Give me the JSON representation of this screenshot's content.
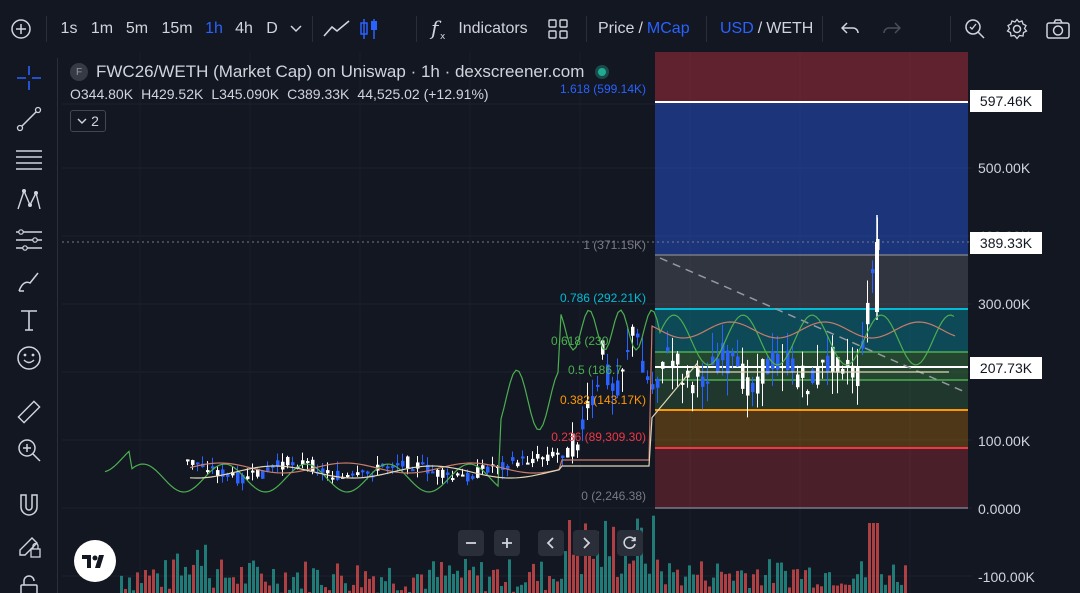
{
  "toolbar": {
    "intervals": [
      "1s",
      "1m",
      "5m",
      "15m",
      "1h",
      "4h",
      "D"
    ],
    "active_interval": "1h",
    "indicators_label": "Indicators",
    "price_label": "Price",
    "slash": "/",
    "mcap_label": "MCap",
    "usd_label": "USD",
    "weth_label": "WETH"
  },
  "legend": {
    "badge": "F",
    "title": "FWC26/WETH (Market Cap) on Uniswap · 1h · dexscreener.com",
    "o_label": "O",
    "o_value": "344.80K",
    "h_label": "H",
    "h_value": "429.52K",
    "l_label": "L",
    "l_value": "345.090K",
    "c_label": "C",
    "c_value": "389.33K",
    "change": "44,525.02 (+12.91%)",
    "indicator_count": "2"
  },
  "price_axis": {
    "labels": [
      "500.00K",
      "300.00K",
      "100.00K",
      "0.0000",
      "-100.00K"
    ],
    "tags": [
      "597.46K",
      "389.33K",
      "207.73K"
    ],
    "partial_label": "400.00K"
  },
  "fib": {
    "levels": [
      {
        "text": "1.618 (599.14K)",
        "color": "#2962ff"
      },
      {
        "text": "1 (371.15K)",
        "color": "#787b86"
      },
      {
        "text": "0.786 (292.21K)",
        "color": "#00bcd4"
      },
      {
        "text": "0.618 (230",
        "color": "#4caf50"
      },
      {
        "text": "0.5 (186.7",
        "color": "#4caf50"
      },
      {
        "text": "0.382 (143.17K)",
        "color": "#ff9800"
      },
      {
        "text": "0.236 (89,309.30)",
        "color": "#f23645"
      },
      {
        "text": "0 (2,246.38)",
        "color": "#787b86"
      }
    ]
  },
  "colors": {
    "background": "#131722",
    "accent": "#2962ff",
    "up": "#ffffff",
    "down": "#2962ff",
    "volume_up": "#26a69a",
    "volume_down": "#ef5350"
  },
  "icons": {
    "left": [
      "crosshair-icon",
      "trend-line-icon",
      "fib-retracement-icon",
      "pattern-icon",
      "prediction-icon",
      "brush-icon",
      "text-icon",
      "emoji-icon",
      "ruler-icon",
      "zoom-in-icon",
      "magnet-icon",
      "lock-drawing-icon",
      "lock-icon"
    ],
    "top": [
      "add-symbol-icon",
      "chart-type-icon",
      "candles-icon",
      "indicators-icon",
      "layouts-icon",
      "undo-icon",
      "redo-icon",
      "search-settings-icon",
      "settings-icon",
      "camera-icon"
    ],
    "nav": [
      "zoom-out-icon",
      "zoom-in-icon",
      "scroll-left-icon",
      "scroll-right-icon",
      "reset-icon"
    ]
  }
}
